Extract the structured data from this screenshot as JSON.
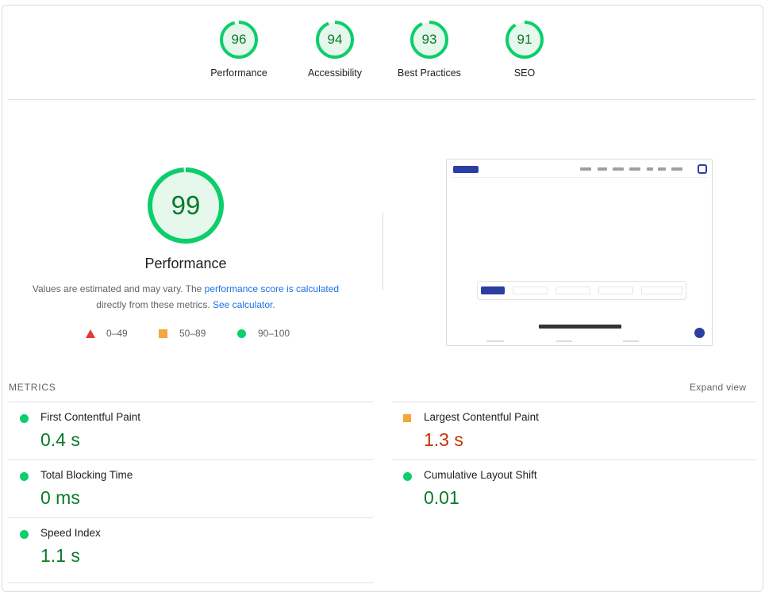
{
  "colors": {
    "pass": "#0cce6b",
    "pass_text": "#0a7a2a",
    "average": "#f4a73a",
    "average_text": "#c33300",
    "fail": "#e53935",
    "link": "#1a73e8"
  },
  "categories": [
    {
      "score": "96",
      "label": "Performance"
    },
    {
      "score": "94",
      "label": "Accessibility"
    },
    {
      "score": "93",
      "label": "Best Practices"
    },
    {
      "score": "91",
      "label": "SEO"
    }
  ],
  "performance": {
    "score": "99",
    "title": "Performance",
    "desc_part1": "Values are estimated and may vary. The ",
    "desc_link1": "performance score is calculated",
    "desc_part2": "directly from these metrics. ",
    "desc_link2": "See calculator",
    "desc_end": "."
  },
  "legend": [
    {
      "shape": "triangle",
      "range": "0–49"
    },
    {
      "shape": "square",
      "range": "50–89"
    },
    {
      "shape": "circle",
      "range": "90–100"
    }
  ],
  "metrics": {
    "heading": "METRICS",
    "expand_label": "Expand view",
    "items": [
      {
        "name": "First Contentful Paint",
        "value": "0.4 s",
        "rating": "pass"
      },
      {
        "name": "Largest Contentful Paint",
        "value": "1.3 s",
        "rating": "average"
      },
      {
        "name": "Total Blocking Time",
        "value": "0 ms",
        "rating": "pass"
      },
      {
        "name": "Cumulative Layout Shift",
        "value": "0.01",
        "rating": "pass"
      },
      {
        "name": "Speed Index",
        "value": "1.1 s",
        "rating": "pass"
      }
    ]
  }
}
